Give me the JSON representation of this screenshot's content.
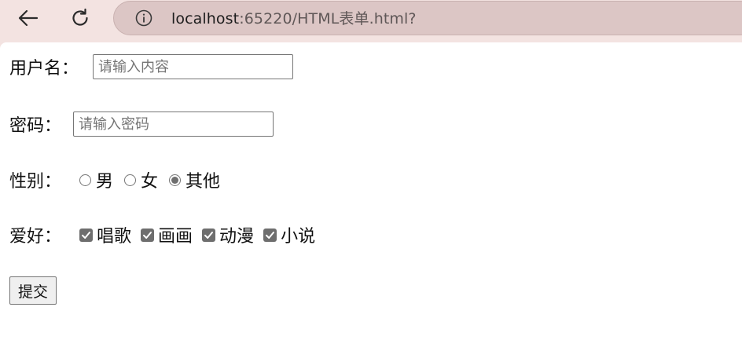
{
  "browser": {
    "url_host": "localhost",
    "url_rest": ":65220/HTML表单.html?"
  },
  "form": {
    "username": {
      "label": "用户名：",
      "placeholder": "请输入内容",
      "value": ""
    },
    "password": {
      "label": "密码：",
      "placeholder": "请输入密码",
      "value": ""
    },
    "gender": {
      "label": "性别：",
      "options": [
        {
          "label": "男",
          "checked": false
        },
        {
          "label": "女",
          "checked": false
        },
        {
          "label": "其他",
          "checked": true
        }
      ]
    },
    "hobby": {
      "label": "爱好：",
      "options": [
        {
          "label": "唱歌",
          "checked": true
        },
        {
          "label": "画画",
          "checked": true
        },
        {
          "label": "动漫",
          "checked": true
        },
        {
          "label": "小说",
          "checked": true
        }
      ]
    },
    "submit_label": "提交"
  }
}
